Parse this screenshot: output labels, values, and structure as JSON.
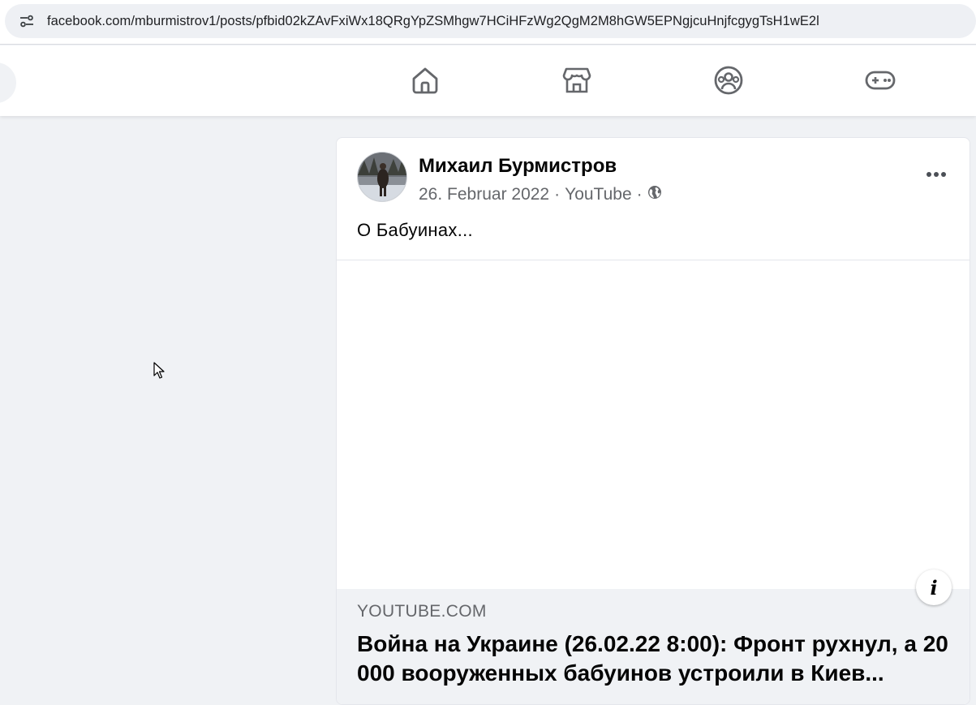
{
  "browser": {
    "url": "facebook.com/mburmistrov1/posts/pfbid02kZAvFxiWx18QRgYpZSMhgw7HCiHFzWg2QgM2M8hGW5EPNgjcuHnjfcgygTsH1wE2l",
    "site_icon": "site-settings-icon"
  },
  "nav": {
    "icons": [
      "home-icon",
      "marketplace-icon",
      "groups-icon",
      "gaming-icon"
    ]
  },
  "post": {
    "author": "Михаил Бурмистров",
    "date": "26. Februar 2022",
    "source": "YouTube",
    "privacy_icon": "globe-icon",
    "text": "О Бабуинах...",
    "link": {
      "domain": "YOUTUBE.COM",
      "title": "Война на Украине (26.02.22 8:00): Фронт рухнул, а 20 000 вооруженных бабуинов устроили в Киев..."
    },
    "info_label": "i"
  },
  "colors": {
    "background": "#f0f2f5",
    "text_primary": "#050505",
    "text_secondary": "#65676b",
    "nav_icon": "#65676b"
  }
}
